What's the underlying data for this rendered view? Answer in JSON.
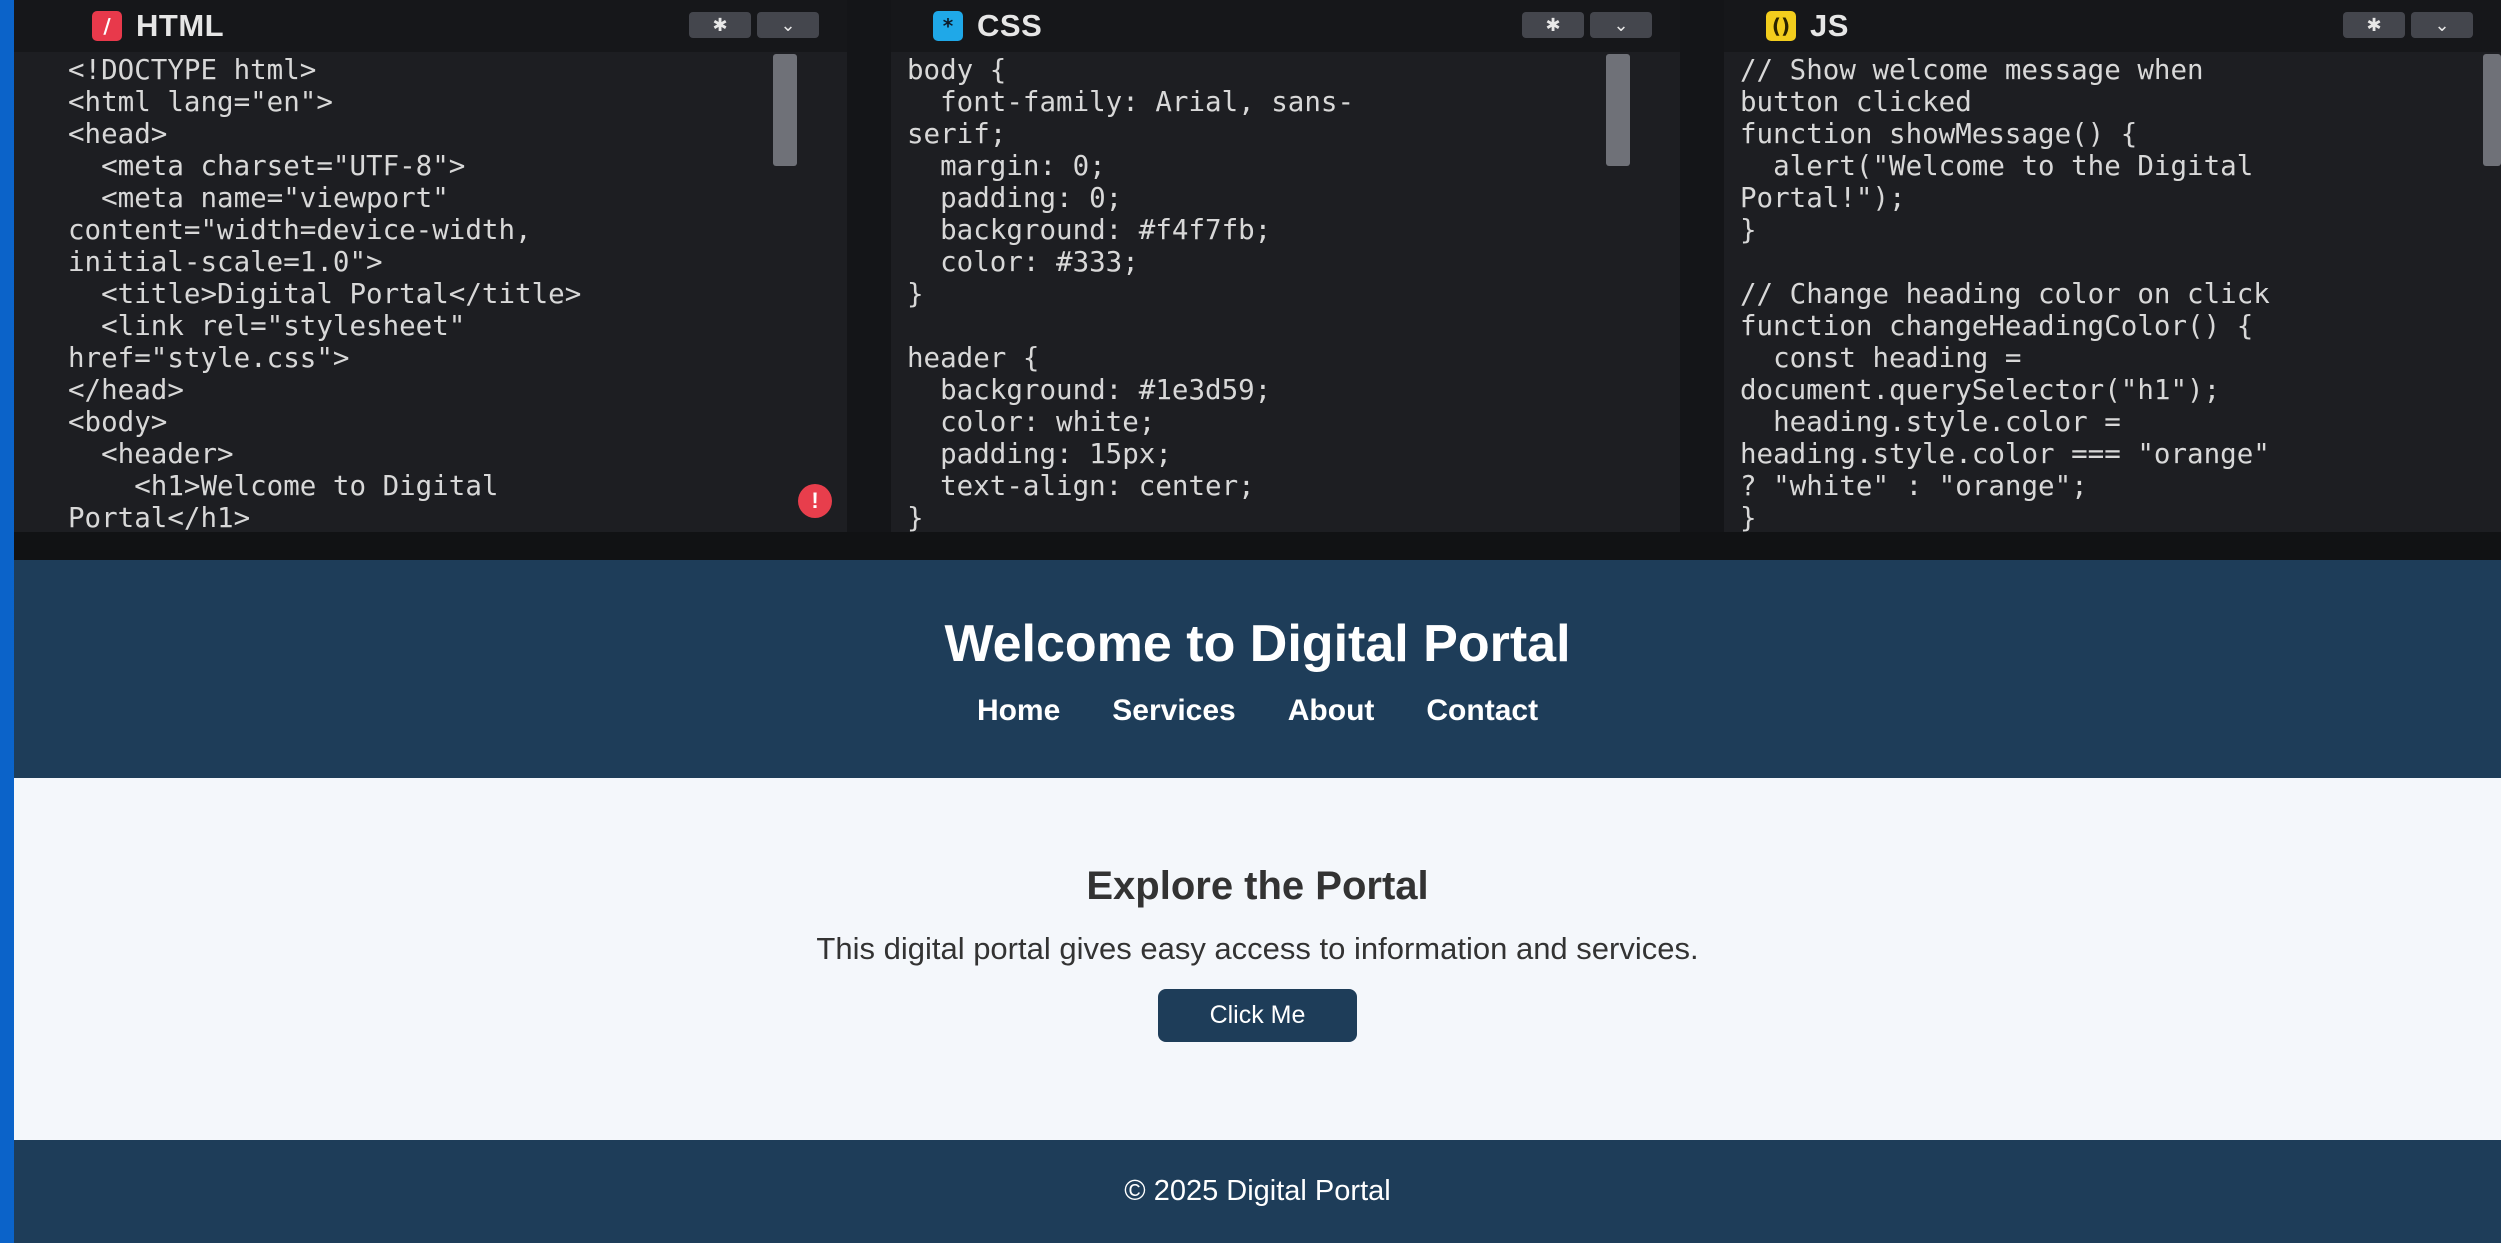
{
  "editors": {
    "html": {
      "title": "HTML",
      "badge": "/",
      "code": "<!DOCTYPE html>\n<html lang=\"en\">\n<head>\n  <meta charset=\"UTF-8\">\n  <meta name=\"viewport\"\ncontent=\"width=device-width,\ninitial-scale=1.0\">\n  <title>Digital Portal</title>\n  <link rel=\"stylesheet\"\nhref=\"style.css\">\n</head>\n<body>\n  <header>\n    <h1>Welcome to Digital\nPortal</h1>"
    },
    "css": {
      "title": "CSS",
      "badge": "*",
      "code": "body {\n  font-family: Arial, sans-\nserif;\n  margin: 0;\n  padding: 0;\n  background: #f4f7fb;\n  color: #333;\n}\n\nheader {\n  background: #1e3d59;\n  color: white;\n  padding: 15px;\n  text-align: center;\n}"
    },
    "js": {
      "title": "JS",
      "badge": "()",
      "code": "// Show welcome message when\nbutton clicked\nfunction showMessage() {\n  alert(\"Welcome to the Digital\nPortal!\");\n}\n\n// Change heading color on click\nfunction changeHeadingColor() {\n  const heading =\ndocument.querySelector(\"h1\");\n  heading.style.color =\nheading.style.color === \"orange\"\n? \"white\" : \"orange\";\n}"
    },
    "settings_icon": "gear-icon",
    "collapse_icon": "chevron-down-icon",
    "error_icon": "!"
  },
  "preview": {
    "title": "Welcome to Digital Portal",
    "nav": [
      "Home",
      "Services",
      "About",
      "Contact"
    ],
    "section_title": "Explore the Portal",
    "section_text": "This digital portal gives easy access to information and services.",
    "button_label": "Click Me",
    "footer": "© 2025 Digital Portal"
  },
  "colors": {
    "header_bg": "#1e3d59",
    "body_bg": "#f4f7fb",
    "text": "#333333",
    "editor_bg": "#1d1e22"
  }
}
